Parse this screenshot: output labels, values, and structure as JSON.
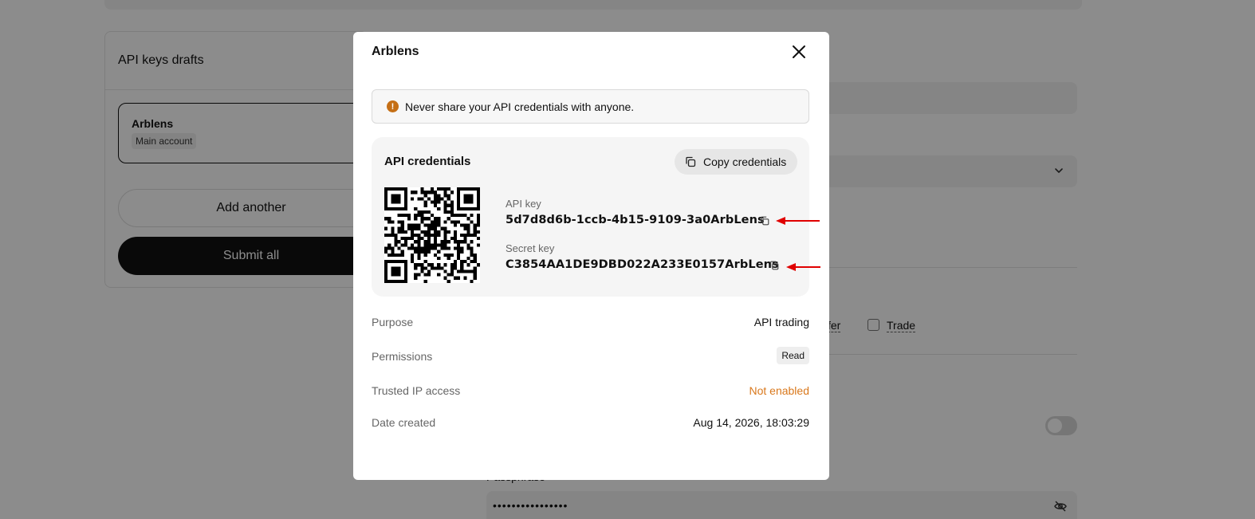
{
  "background": {
    "drafts_title": "API keys drafts",
    "draft_item": {
      "name": "Arblens",
      "tag": "Main account"
    },
    "add_another_label": "Add another",
    "submit_all_label": "Submit all",
    "transfer_label": "fer",
    "trade_label": "Trade",
    "passphrase_label": "Passphrase",
    "passphrase_value": "••••••••••••••••"
  },
  "modal": {
    "title": "Arblens",
    "warning_text": "Never share your API credentials with anyone.",
    "credentials_title": "API credentials",
    "copy_credentials_label": "Copy credentials",
    "api_key_label": "API key",
    "api_key_value": "5d7d8d6b-1ccb-4b15-9109-3a0ArbLens",
    "secret_key_label": "Secret key",
    "secret_key_value": "C3854AA1DE9DBD022A233E0157ArbLens",
    "details": [
      {
        "label": "Purpose",
        "value": "API trading"
      },
      {
        "label": "Permissions",
        "value": "Read"
      },
      {
        "label": "Trusted IP access",
        "value": "Not enabled"
      },
      {
        "label": "Date created",
        "value": "Aug 14, 2026, 18:03:29"
      }
    ]
  },
  "colors": {
    "warning_icon": "#c56f16",
    "not_enabled": "#d9781c",
    "annotation_arrow": "#e00000"
  }
}
